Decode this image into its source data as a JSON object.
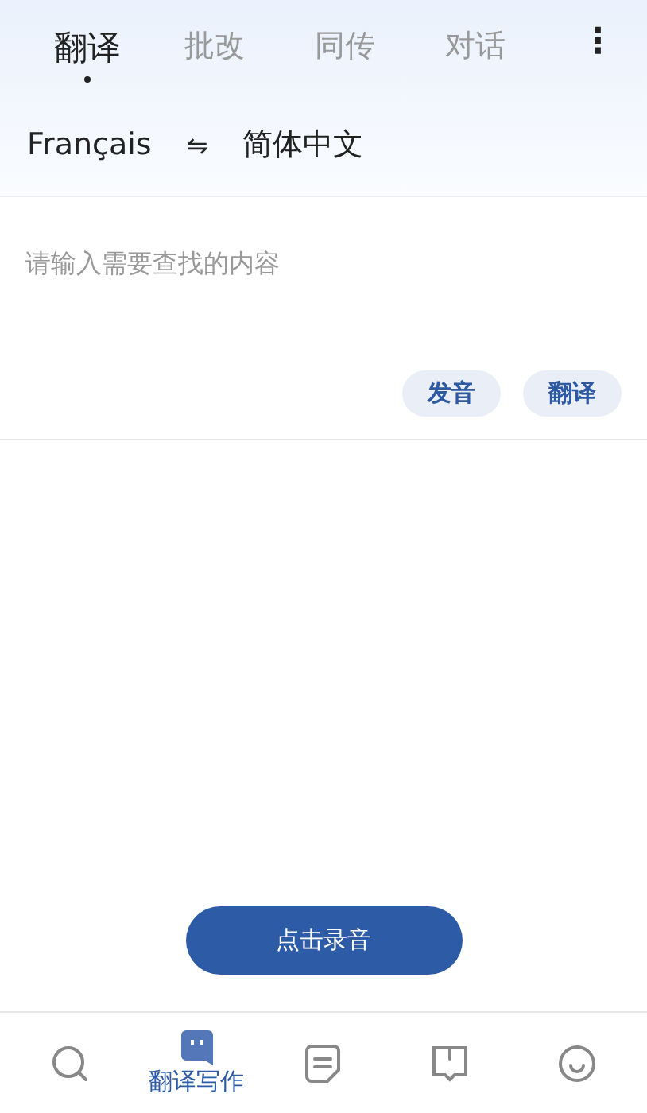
{
  "tabs": [
    {
      "label": "翻译",
      "selected": true
    },
    {
      "label": "批改",
      "selected": false
    },
    {
      "label": "同传",
      "selected": false
    },
    {
      "label": "对话",
      "selected": false
    }
  ],
  "menu_icon": "⋮",
  "languages": {
    "source": "Français",
    "swap": "⇋",
    "target": "简体中文"
  },
  "input": {
    "placeholder": "请输入需要查找的内容"
  },
  "actions": [
    "发音",
    "翻译"
  ],
  "record_button": "点击录音",
  "bottom_nav": [
    {
      "kind": "search",
      "selected": false
    },
    {
      "kind": "chat",
      "selected": true,
      "label": "翻译写作"
    },
    {
      "kind": "note",
      "selected": false
    },
    {
      "kind": "book",
      "selected": false
    },
    {
      "kind": "smile",
      "selected": false
    }
  ]
}
